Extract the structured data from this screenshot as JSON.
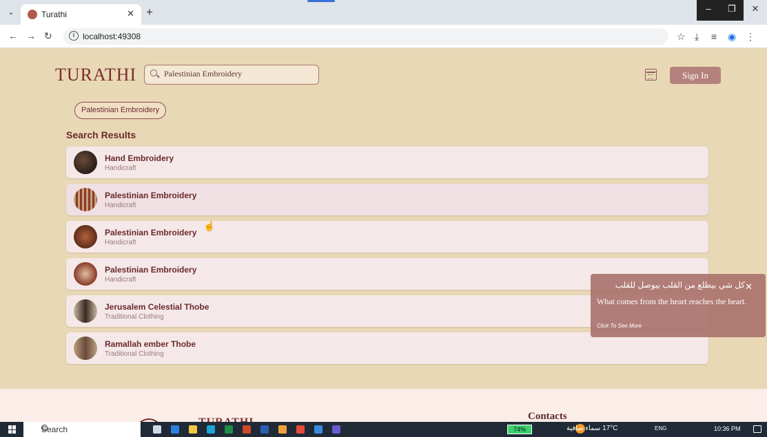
{
  "browser": {
    "tab_title": "Turathi",
    "url": "localhost:49308"
  },
  "header": {
    "logo": "TURATHI",
    "search_value": "Palestinian Embroidery",
    "signin_label": "Sign In"
  },
  "filter_chip": "Palestinian Embroidery",
  "results_title": "Search Results",
  "results": [
    {
      "title": "Hand Embroidery",
      "category": "Handicraft"
    },
    {
      "title": "Palestinian Embroidery",
      "category": "Handicraft"
    },
    {
      "title": "Palestinian Embroidery",
      "category": "Handicraft"
    },
    {
      "title": "Palestinian Embroidery",
      "category": "Handicraft"
    },
    {
      "title": "Jerusalem Celestial Thobe",
      "category": "Traditional Clothing"
    },
    {
      "title": "Ramallah ember Thobe",
      "category": "Traditional Clothing"
    }
  ],
  "toast": {
    "arabic": "كل شي بيطلع من القلب بيوصل للقلب",
    "english": "What comes from the heart reaches the heart.",
    "more": "Click To See More"
  },
  "footer": {
    "logo": "TURATHI",
    "contacts": "Contacts"
  },
  "taskbar": {
    "search": "Search",
    "battery": "74%",
    "weather": "17°C سماء صافية",
    "lang": "ENG",
    "time": "10:36 PM"
  },
  "colors": {
    "background": "#e9d8b6",
    "brand": "#7a2f2f",
    "card": "#f5e8e9",
    "button": "#b5817c"
  }
}
